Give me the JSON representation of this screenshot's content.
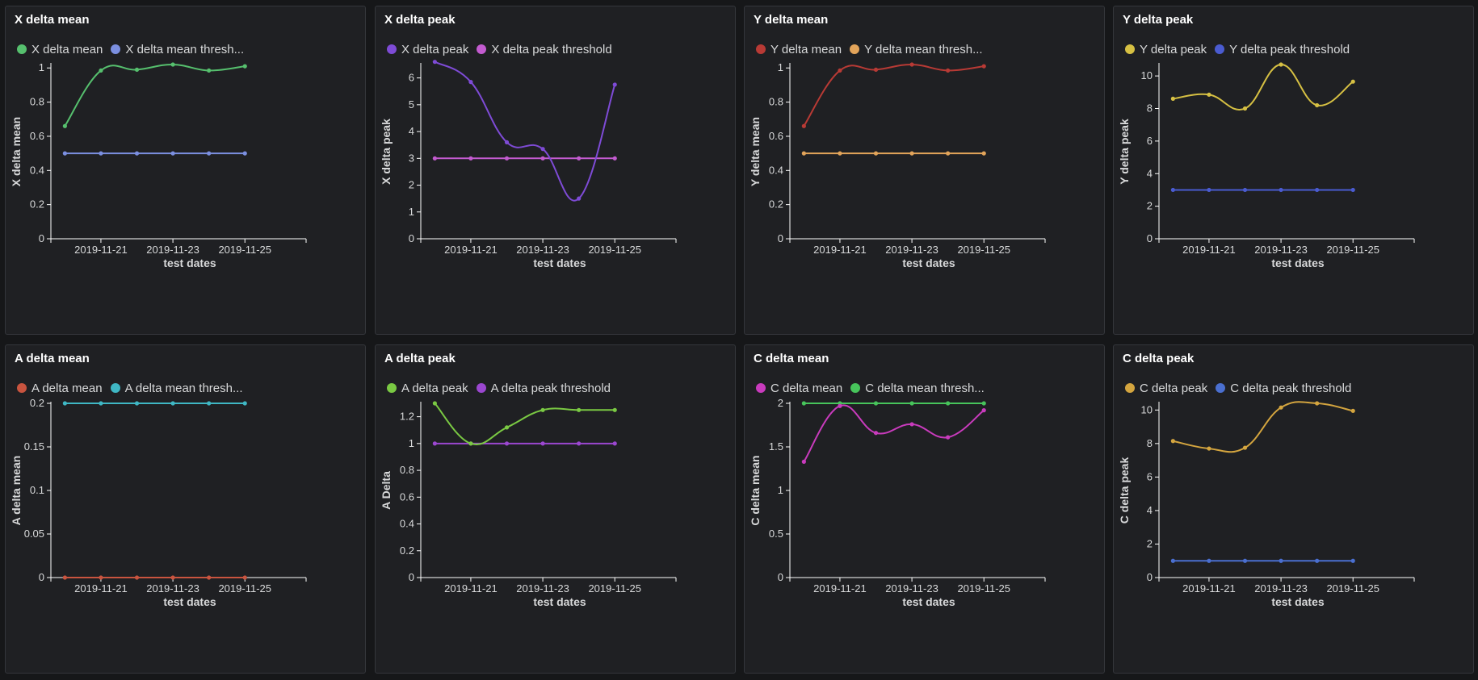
{
  "chart_data": [
    {
      "id": "x-delta-mean",
      "type": "line",
      "title": "X delta mean",
      "xlabel": "test dates",
      "ylabel": "X delta mean",
      "x": [
        "2019-11-20",
        "2019-11-21",
        "2019-11-22",
        "2019-11-23",
        "2019-11-24",
        "2019-11-25"
      ],
      "xticks": [
        "2019-11-21",
        "2019-11-23",
        "2019-11-25"
      ],
      "ylim": [
        0,
        1.02
      ],
      "yticks": [
        "0",
        "0.2",
        "0.4",
        "0.6",
        "0.8",
        "1"
      ],
      "series": [
        {
          "name": "X delta mean",
          "legend": "X delta mean",
          "color": "#56c06e",
          "values": [
            0.66,
            0.985,
            0.99,
            1.02,
            0.985,
            1.01
          ]
        },
        {
          "name": "X delta mean threshold",
          "legend": "X delta mean thresh...",
          "color": "#7b8fe0",
          "values": [
            0.5,
            0.5,
            0.5,
            0.5,
            0.5,
            0.5
          ]
        }
      ]
    },
    {
      "id": "x-delta-peak",
      "type": "line",
      "title": "X delta peak",
      "xlabel": "test dates",
      "ylabel": "X delta peak",
      "x": [
        "2019-11-20",
        "2019-11-21",
        "2019-11-22",
        "2019-11-23",
        "2019-11-24",
        "2019-11-25"
      ],
      "xticks": [
        "2019-11-21",
        "2019-11-23",
        "2019-11-25"
      ],
      "ylim": [
        0,
        6.5
      ],
      "yticks": [
        "0",
        "1",
        "2",
        "3",
        "4",
        "5",
        "6"
      ],
      "series": [
        {
          "name": "X delta peak",
          "legend": "X delta peak",
          "color": "#7e4bd6",
          "values": [
            6.6,
            5.85,
            3.6,
            3.35,
            1.5,
            5.75
          ]
        },
        {
          "name": "X delta peak threshold",
          "legend": "X delta peak threshold",
          "color": "#c35bd0",
          "values": [
            3,
            3,
            3,
            3,
            3,
            3
          ]
        }
      ]
    },
    {
      "id": "y-delta-mean",
      "type": "line",
      "title": "Y delta mean",
      "xlabel": "test dates",
      "ylabel": "Y delta mean",
      "x": [
        "2019-11-20",
        "2019-11-21",
        "2019-11-22",
        "2019-11-23",
        "2019-11-24",
        "2019-11-25"
      ],
      "xticks": [
        "2019-11-21",
        "2019-11-23",
        "2019-11-25"
      ],
      "ylim": [
        0,
        1.02
      ],
      "yticks": [
        "0",
        "0.2",
        "0.4",
        "0.6",
        "0.8",
        "1"
      ],
      "series": [
        {
          "name": "Y delta mean",
          "legend": "Y delta mean",
          "color": "#b83a35",
          "values": [
            0.66,
            0.985,
            0.99,
            1.02,
            0.985,
            1.01
          ]
        },
        {
          "name": "Y delta mean threshold",
          "legend": "Y delta mean thresh...",
          "color": "#e2a45a",
          "values": [
            0.5,
            0.5,
            0.5,
            0.5,
            0.5,
            0.5
          ]
        }
      ]
    },
    {
      "id": "y-delta-peak",
      "type": "line",
      "title": "Y delta peak",
      "xlabel": "test dates",
      "ylabel": "Y delta peak",
      "x": [
        "2019-11-20",
        "2019-11-21",
        "2019-11-22",
        "2019-11-23",
        "2019-11-24",
        "2019-11-25"
      ],
      "xticks": [
        "2019-11-21",
        "2019-11-23",
        "2019-11-25"
      ],
      "ylim": [
        0,
        10.7
      ],
      "yticks": [
        "0",
        "2",
        "4",
        "6",
        "8",
        "10"
      ],
      "series": [
        {
          "name": "Y delta peak",
          "legend": "Y delta peak",
          "color": "#d6c043",
          "values": [
            8.6,
            8.85,
            8.0,
            10.7,
            8.2,
            9.65
          ]
        },
        {
          "name": "Y delta peak threshold",
          "legend": "Y delta peak threshold",
          "color": "#4a5bd0",
          "values": [
            3,
            3,
            3,
            3,
            3,
            3
          ]
        }
      ]
    },
    {
      "id": "a-delta-mean",
      "type": "line",
      "title": "A delta mean",
      "xlabel": "test dates",
      "ylabel": "A delta mean",
      "x": [
        "2019-11-20",
        "2019-11-21",
        "2019-11-22",
        "2019-11-23",
        "2019-11-24",
        "2019-11-25"
      ],
      "xticks": [
        "2019-11-21",
        "2019-11-23",
        "2019-11-25"
      ],
      "ylim": [
        0,
        0.2
      ],
      "yticks": [
        "0",
        "0.05",
        "0.1",
        "0.15",
        "0.2"
      ],
      "series": [
        {
          "name": "A delta mean",
          "legend": "A delta mean",
          "color": "#c9543f",
          "values": [
            0,
            0,
            0,
            0,
            0,
            0
          ]
        },
        {
          "name": "A delta mean threshold",
          "legend": "A delta mean thresh...",
          "color": "#3fb7c4",
          "values": [
            0.2,
            0.2,
            0.2,
            0.2,
            0.2,
            0.2
          ]
        }
      ]
    },
    {
      "id": "a-delta-peak",
      "type": "line",
      "title": "A delta peak",
      "xlabel": "test dates",
      "ylabel": "A Delta",
      "x": [
        "2019-11-20",
        "2019-11-21",
        "2019-11-22",
        "2019-11-23",
        "2019-11-24",
        "2019-11-25"
      ],
      "xticks": [
        "2019-11-21",
        "2019-11-23",
        "2019-11-25"
      ],
      "ylim": [
        0,
        1.3
      ],
      "yticks": [
        "0",
        "0.2",
        "0.4",
        "0.6",
        "0.8",
        "1",
        "1.2"
      ],
      "series": [
        {
          "name": "A delta peak",
          "legend": "A delta peak",
          "color": "#7ac943",
          "values": [
            1.3,
            1.0,
            1.12,
            1.25,
            1.25,
            1.25
          ]
        },
        {
          "name": "A delta peak threshold",
          "legend": "A delta peak threshold",
          "color": "#9b47d0",
          "values": [
            1,
            1,
            1,
            1,
            1,
            1
          ]
        }
      ]
    },
    {
      "id": "c-delta-mean",
      "type": "line",
      "title": "C delta mean",
      "xlabel": "test dates",
      "ylabel": "C delta mean",
      "x": [
        "2019-11-20",
        "2019-11-21",
        "2019-11-22",
        "2019-11-23",
        "2019-11-24",
        "2019-11-25"
      ],
      "xticks": [
        "2019-11-21",
        "2019-11-23",
        "2019-11-25"
      ],
      "ylim": [
        0,
        2
      ],
      "yticks": [
        "0",
        "0.5",
        "1",
        "1.5",
        "2"
      ],
      "series": [
        {
          "name": "C delta mean",
          "legend": "C delta mean",
          "color": "#c93bbd",
          "values": [
            1.33,
            1.97,
            1.66,
            1.76,
            1.61,
            1.92
          ]
        },
        {
          "name": "C delta mean threshold",
          "legend": "C delta mean thresh...",
          "color": "#47c45b",
          "values": [
            2,
            2,
            2,
            2,
            2,
            2
          ]
        }
      ]
    },
    {
      "id": "c-delta-peak",
      "type": "line",
      "title": "C delta peak",
      "xlabel": "test dates",
      "ylabel": "C delta peak",
      "x": [
        "2019-11-20",
        "2019-11-21",
        "2019-11-22",
        "2019-11-23",
        "2019-11-24",
        "2019-11-25"
      ],
      "xticks": [
        "2019-11-21",
        "2019-11-23",
        "2019-11-25"
      ],
      "ylim": [
        0,
        10.4
      ],
      "yticks": [
        "0",
        "2",
        "4",
        "6",
        "8",
        "10"
      ],
      "series": [
        {
          "name": "C delta peak",
          "legend": "C delta peak",
          "color": "#d4a53f",
          "values": [
            8.15,
            7.7,
            7.75,
            10.15,
            10.4,
            9.95
          ]
        },
        {
          "name": "C delta peak threshold",
          "legend": "C delta peak threshold",
          "color": "#4a6fd0",
          "values": [
            1,
            1,
            1,
            1,
            1,
            1
          ]
        }
      ]
    }
  ]
}
